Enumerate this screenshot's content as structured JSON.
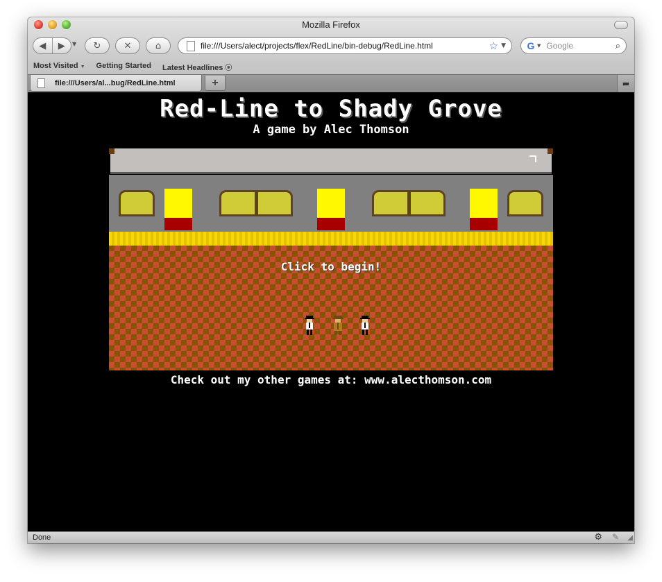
{
  "window": {
    "title": "Mozilla Firefox"
  },
  "toolbar": {
    "back_icon": "◀",
    "forward_icon": "▶",
    "reload_icon": "↻",
    "stop_icon": "✕",
    "home_icon": "⌂",
    "url": "file:///Users/alect/projects/flex/RedLine/bin-debug/RedLine.html",
    "search_placeholder": "Google"
  },
  "bookmarks": [
    {
      "label": "Most Visited"
    },
    {
      "label": "Getting Started"
    },
    {
      "label": "Latest Headlines"
    }
  ],
  "tabs": [
    {
      "label": "file:///Users/al...bug/RedLine.html"
    }
  ],
  "new_tab_label": "+",
  "page": {
    "title": "Red-Line to Shady Grove",
    "subtitle": "A game by Alec Thomson",
    "start_message": "Click to begin!",
    "footer": "Check out my other games at: www.alecthomson.com"
  },
  "status": {
    "text": "Done"
  },
  "colors": {
    "floor_dark": "#8a5300",
    "floor_light": "#c84d35",
    "platform_edge": "#f7d800",
    "door_yellow": "#fff800",
    "door_red": "#a80000",
    "window_glass": "#cfcc38"
  }
}
